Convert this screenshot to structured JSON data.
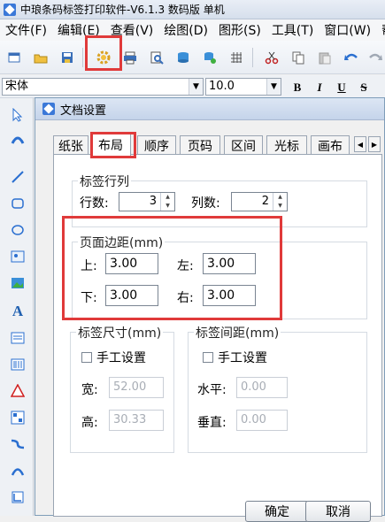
{
  "app": {
    "title": "中琅条码标签打印软件-V6.1.3 数码版 单机"
  },
  "menu": [
    "文件(F)",
    "编辑(E)",
    "查看(V)",
    "绘图(D)",
    "图形(S)",
    "工具(T)",
    "窗口(W)",
    "帮"
  ],
  "toolbar": {
    "icons": [
      "new-icon",
      "open-icon",
      "save-icon",
      "settings-gear-icon",
      "print-icon",
      "print-preview-icon",
      "database-icon",
      "database-settings-icon",
      "grid-icon",
      "cut-icon",
      "copy-icon",
      "paste-icon",
      "undo-icon",
      "redo-icon"
    ]
  },
  "font_toolbar": {
    "font_name": "宋体",
    "font_size": "10.0",
    "bold": "B",
    "italic": "I",
    "underline": "U",
    "strike": "S"
  },
  "dialog": {
    "title": "文档设置",
    "tabs": [
      "纸张",
      "布局",
      "顺序",
      "页码",
      "区间",
      "光标",
      "画布"
    ],
    "active_tab": "布局",
    "label_rows_cols": {
      "title": "标签行列",
      "rows_label": "行数:",
      "rows_value": "3",
      "cols_label": "列数:",
      "cols_value": "2"
    },
    "page_margin": {
      "title": "页面边距(mm)",
      "top_label": "上:",
      "top_value": "3.00",
      "left_label": "左:",
      "left_value": "3.00",
      "bottom_label": "下:",
      "bottom_value": "3.00",
      "right_label": "右:",
      "right_value": "3.00"
    },
    "label_size": {
      "title": "标签尺寸(mm)",
      "manual": "手工设置",
      "width_label": "宽:",
      "width_value": "52.00",
      "height_label": "高:",
      "height_value": "30.33"
    },
    "label_spacing": {
      "title": "标签间距(mm)",
      "manual": "手工设置",
      "horizontal_label": "水平:",
      "horizontal_value": "0.00",
      "vertical_label": "垂直:",
      "vertical_value": "0.00"
    },
    "ok_label": "确定",
    "cancel_label": "取消"
  },
  "colors": {
    "highlight": "#e03a3a",
    "accent": "#3a78d8"
  }
}
